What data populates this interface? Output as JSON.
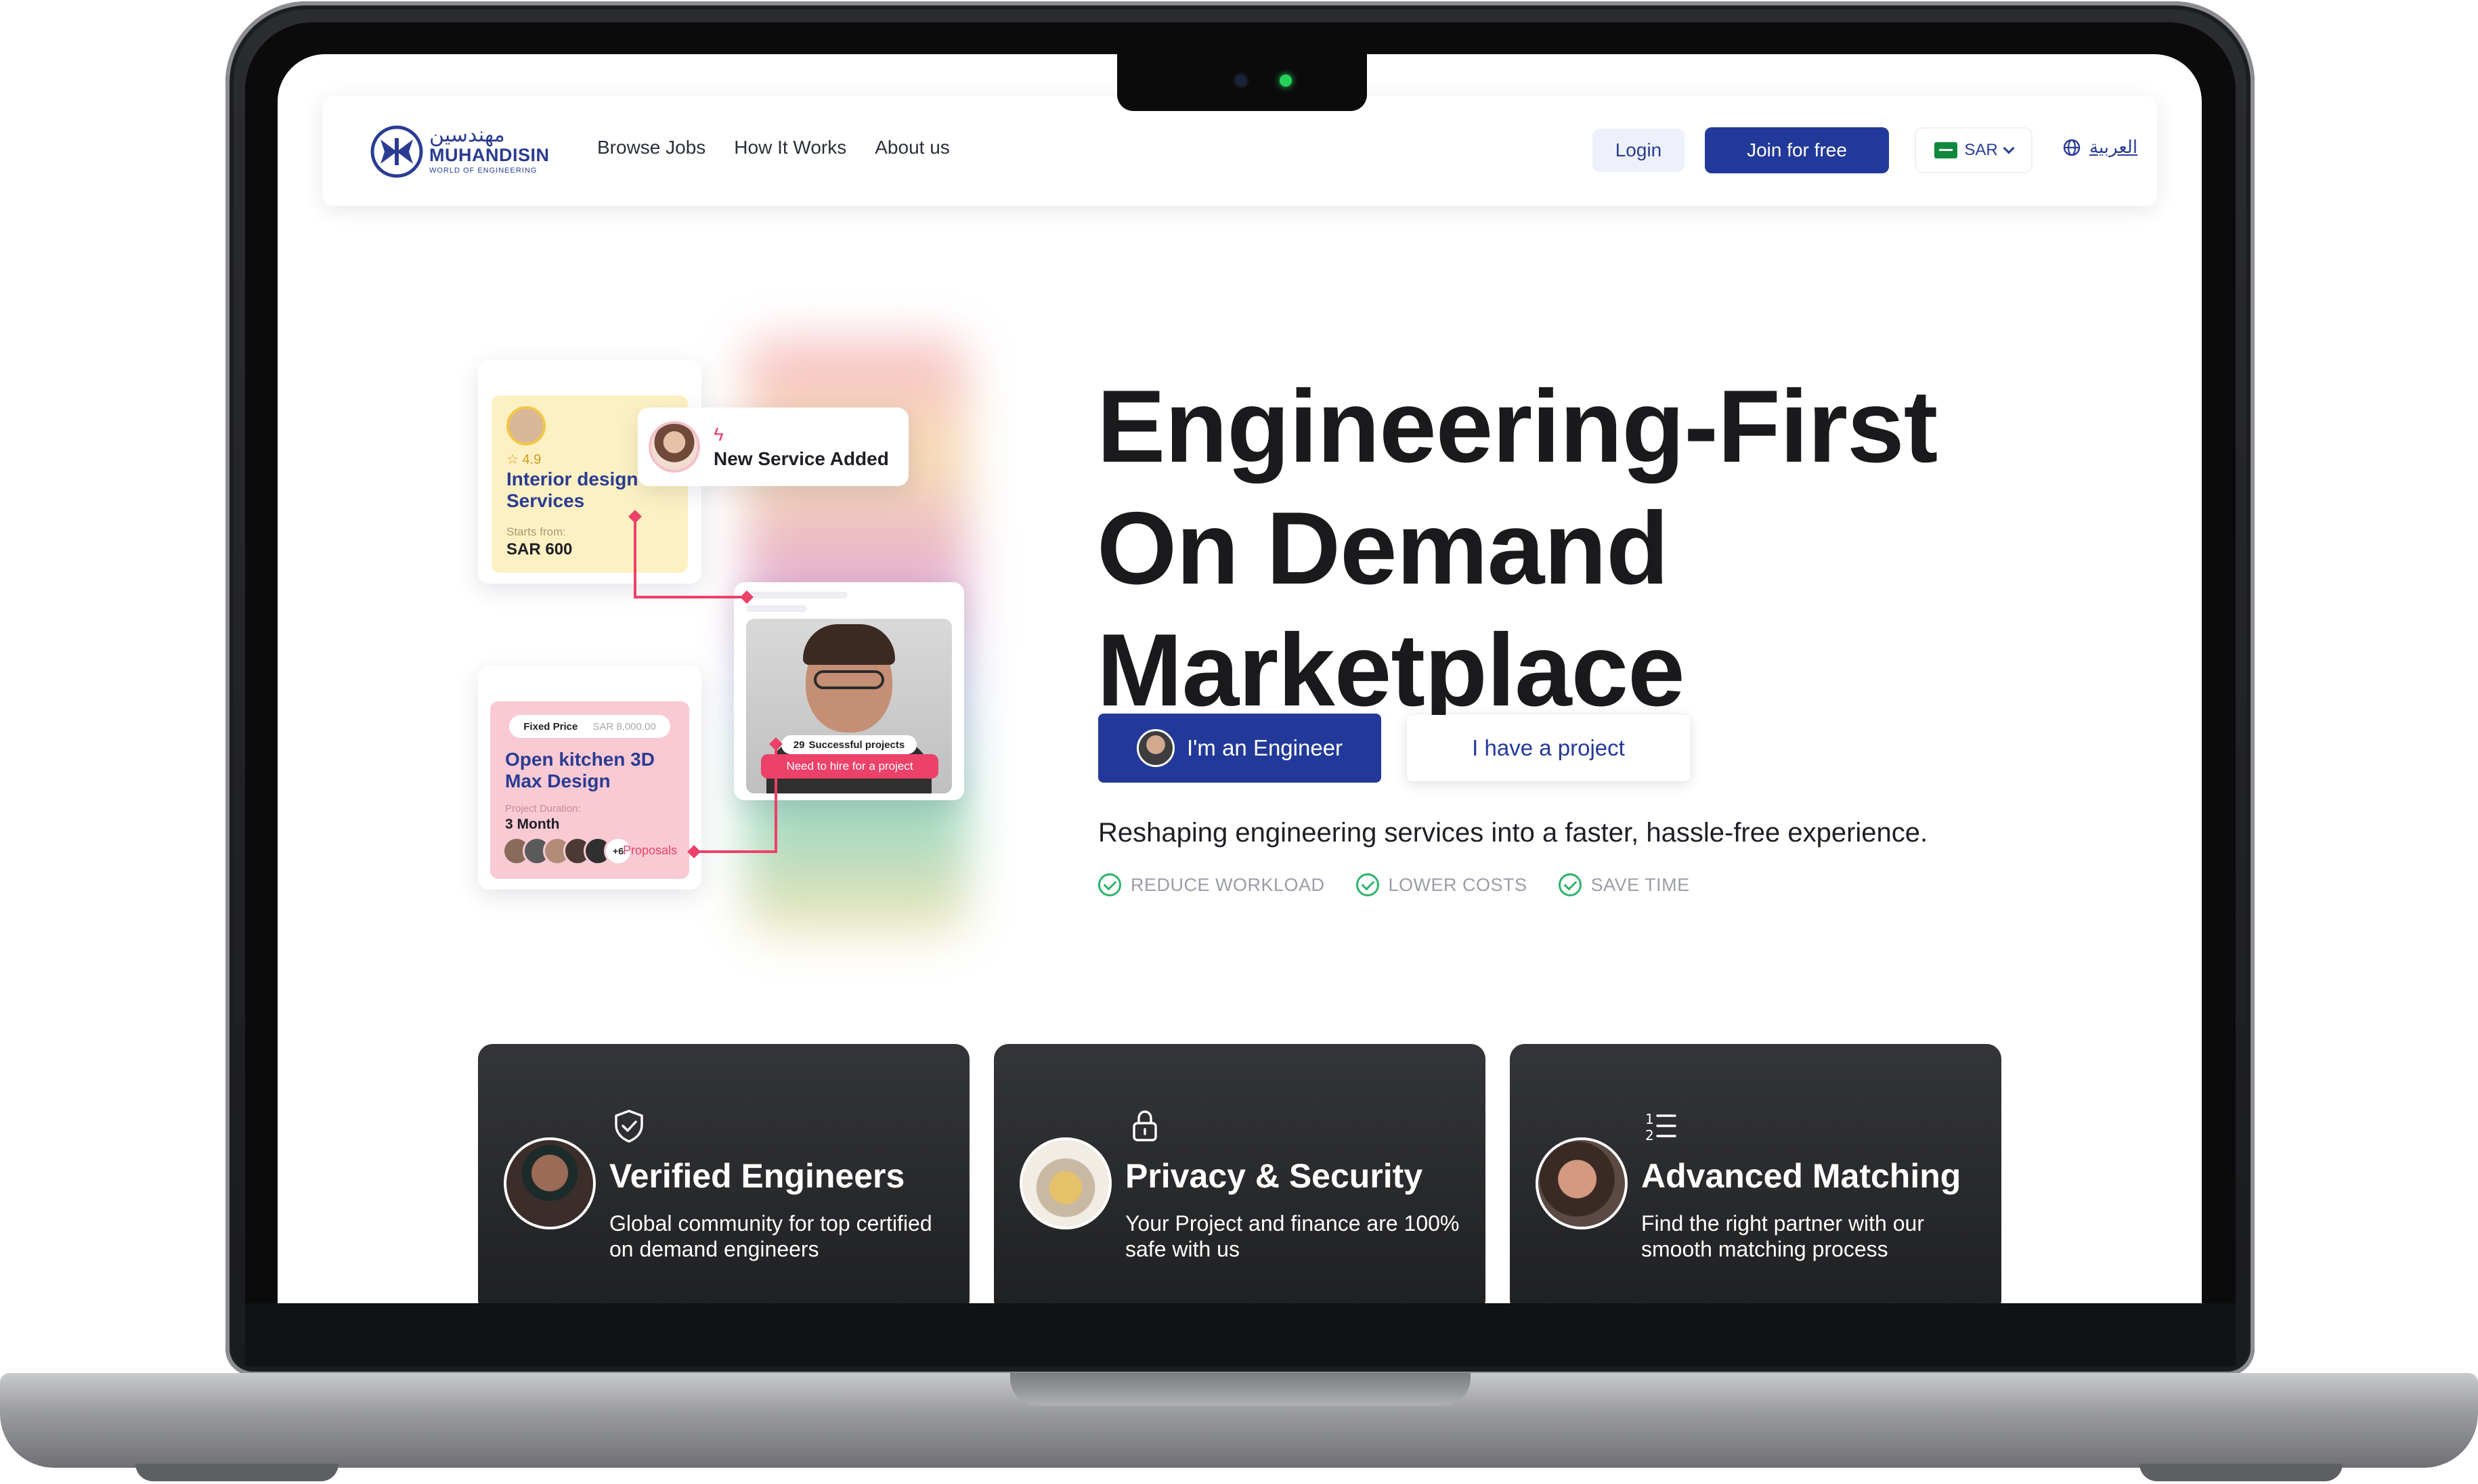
{
  "nav": {
    "logo_arabic": "مهندسين",
    "logo_name": "MUHANDISIN",
    "logo_tagline": "WORLD OF ENGINEERING",
    "links": [
      "Browse Jobs",
      "How It Works",
      "About us"
    ],
    "login_label": "Login",
    "join_label": "Join for free",
    "currency": "SAR",
    "language": "العربية"
  },
  "collage": {
    "service_card": {
      "rating": "4.9",
      "title": "Interior design Services",
      "starts_from_label": "Starts from:",
      "price": "SAR 600"
    },
    "notification": "New Service Added",
    "profile_card": {
      "projects_count": "29",
      "projects_label": "Successful projects",
      "hire_label": "Need to hire for a project"
    },
    "project_card": {
      "pricing_type": "Fixed Price",
      "price": "SAR 8,000.00",
      "title": "Open kitchen 3D Max Design",
      "duration_label": "Project Duration:",
      "duration": "3 Month",
      "more_count": "+6",
      "proposals_label": "Proposals"
    }
  },
  "hero": {
    "title_lines": [
      "Engineering-First",
      "On Demand",
      "Marketplace"
    ],
    "engineer_button": "I'm an Engineer",
    "project_button": "I have a project",
    "tagline": "Reshaping engineering services into a faster, hassle-free experience.",
    "benefits": [
      "REDUCE WORKLOAD",
      "LOWER COSTS",
      "SAVE TIME"
    ]
  },
  "features": [
    {
      "title": "Verified Engineers",
      "description": "Global community for top certified on demand engineers",
      "icon": "shield-check-icon"
    },
    {
      "title": "Privacy & Security",
      "description": "Your Project and finance are 100% safe with us",
      "icon": "lock-icon"
    },
    {
      "title": "Advanced Matching",
      "description": "Find the right partner with our smooth matching process",
      "icon": "numbered-list-icon"
    }
  ],
  "colors": {
    "brand_blue": "#23399a",
    "accent_pink": "#ec4169",
    "success_green": "#2db36b",
    "dark_card": "#2a2b2e"
  }
}
